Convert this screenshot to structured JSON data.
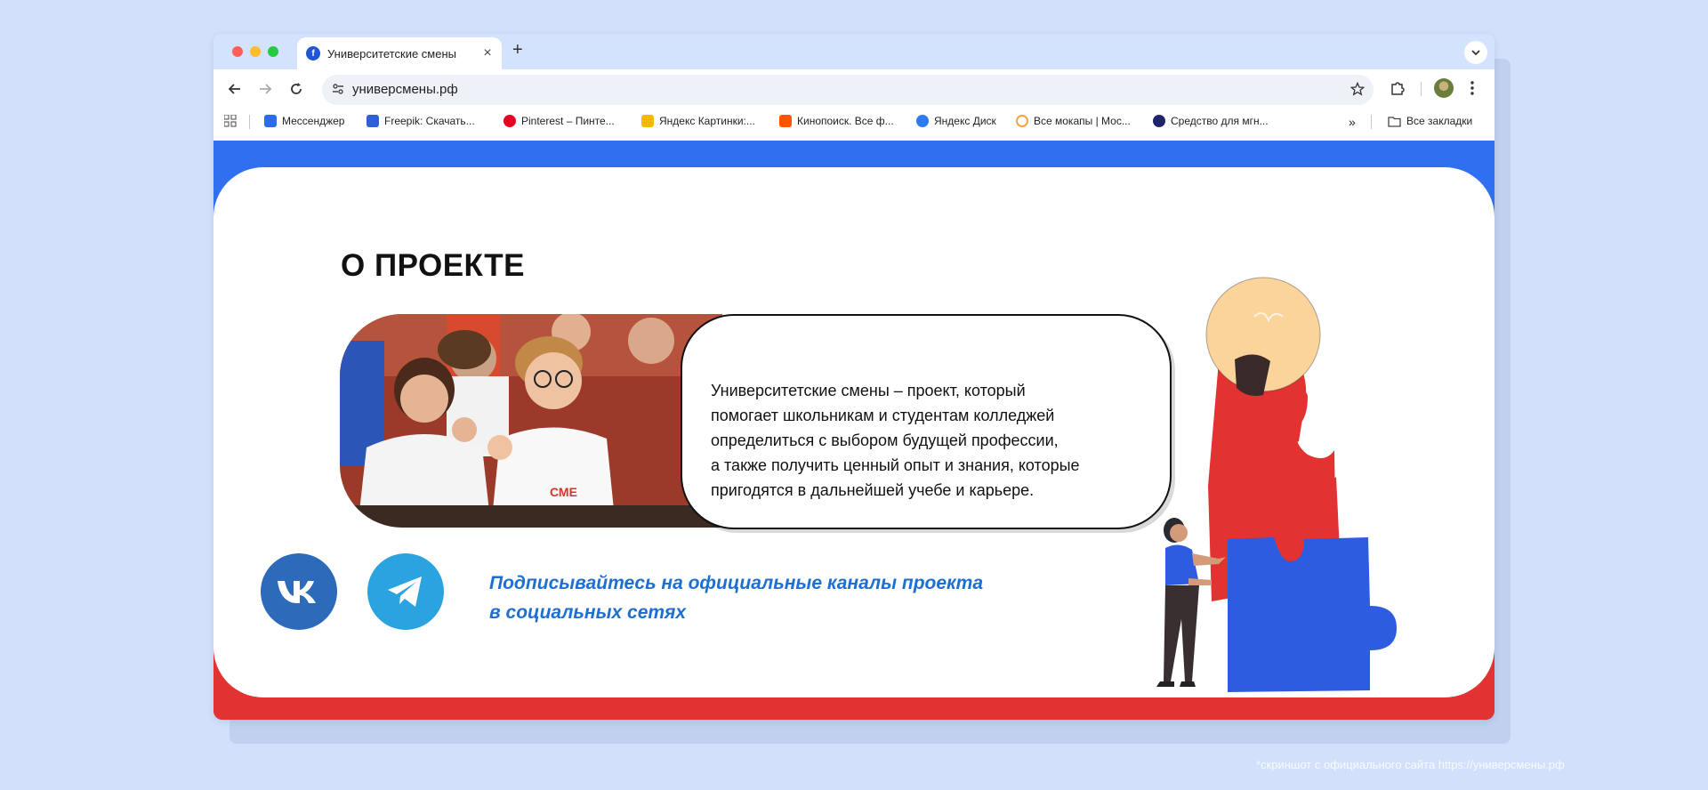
{
  "browser": {
    "tab": {
      "title": "Университетские смены",
      "favicon_letter": "f"
    },
    "address": {
      "url": "универсмены.рф"
    },
    "bookmarks": [
      {
        "label": "Мессенджер",
        "color": "#2b6de8"
      },
      {
        "label": "Freepik: Скачать...",
        "color": "#2f5fd6"
      },
      {
        "label": "Pinterest – Пинте...",
        "color": "#e60023"
      },
      {
        "label": "Яндекс Картинки:...",
        "color": "#f5b800"
      },
      {
        "label": "Кинопоиск. Все ф...",
        "color": "#ff5500"
      },
      {
        "label": "Яндекс Диск",
        "color": "#2e7bf0"
      },
      {
        "label": "Все мокапы | Мос...",
        "color": "#f4a340"
      },
      {
        "label": "Средство для мгн...",
        "color": "#20246b"
      }
    ],
    "all_bookmarks_label": "Все закладки",
    "colors": {
      "tab_strip": "#d3e3fd",
      "close_light": "#ff5f57",
      "min_light": "#febc2e",
      "max_light": "#28c840"
    }
  },
  "page": {
    "heading": "О ПРОЕКТЕ",
    "about_lines": [
      "Университетские смены – проект, который",
      "помогает школьникам и студентам колледжей",
      "определиться с выбором будущей профессии,",
      "а также получить ценный опыт и знания, которые",
      "пригодятся в дальнейшей учебе и карьере."
    ],
    "subscribe_lines": [
      "Подписывайтесь на официальные каналы проекта",
      "в социальных сетях"
    ],
    "social": [
      {
        "name": "vk",
        "color": "#2d6aba"
      },
      {
        "name": "telegram",
        "color": "#2aa3e0"
      }
    ],
    "colors": {
      "blue": "#2f6ff0",
      "red": "#e23232",
      "accent_text": "#1d6fd0"
    }
  },
  "footer_note": "*скриншот с официального сайта https://универсмены.рф"
}
